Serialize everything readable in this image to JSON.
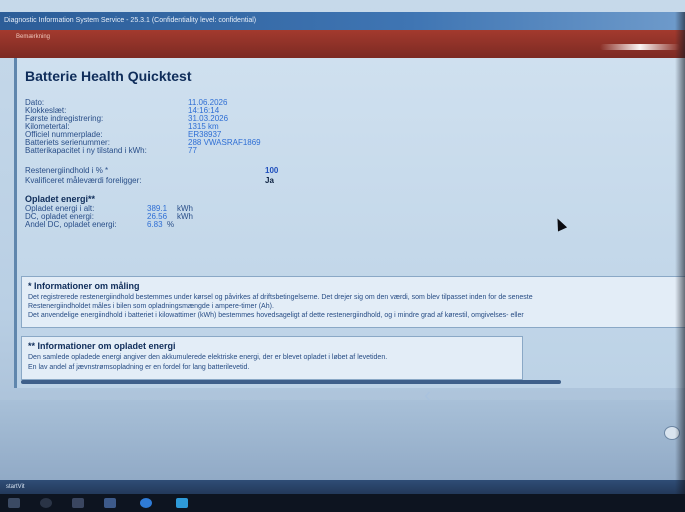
{
  "window": {
    "title": "Diagnostic Information System Service - 25.3.1 (Confidentiality level: confidential)"
  },
  "app": {
    "menu_label": "Bemærkning"
  },
  "page": {
    "heading": "Batterie Health Quicktest"
  },
  "details": [
    {
      "label": "Dato:",
      "value": "11.06.2026"
    },
    {
      "label": "Klokkeslæt:",
      "value": "14:16:14"
    },
    {
      "label": "Første indregistrering:",
      "value": "31.03.2026"
    },
    {
      "label": "Kilometertal:",
      "value": "1315 km"
    },
    {
      "label": "Officiel nummerplade:",
      "value": "ER38937"
    },
    {
      "label": "Batteriets serienummer:",
      "value": "288 VWASRAF1869"
    },
    {
      "label": "Batterikapacitet i ny tilstand i kWh:",
      "value": "77"
    }
  ],
  "residual": [
    {
      "label": "Restenergiindhold i % *",
      "value": "100"
    },
    {
      "label": "Kvalificeret måleværdi foreligger:",
      "value": "Ja"
    }
  ],
  "charged": {
    "title": "Opladet energi**",
    "rows": [
      {
        "label": "Opladet energi i alt:",
        "value": "389.1",
        "unit": "kWh"
      },
      {
        "label": "DC, opladet energi:",
        "value": "26.56",
        "unit": "kWh"
      },
      {
        "label": "Andel DC, opladet energi:",
        "value": "6.83",
        "unit": "%"
      }
    ]
  },
  "info_measure": {
    "title": "* Informationer om måling",
    "lines": [
      "Det registrerede restenergiindhold bestemmes under kørsel og påvirkes af driftsbetingelserne. Det drejer sig om den værdi, som blev tilpasset inden for de seneste",
      "Restenergiindholdet måles i bilen som opladningsmængde i ampere-timer (Ah).",
      "Det anvendelige energiindhold i batteriet i kilowattimer (kWh) bestemmes hovedsageligt af dette restenergiindhold, og i mindre grad af kørestil, omgivelses- eller"
    ]
  },
  "info_charged": {
    "title": "** Informationer om opladet energi",
    "lines": [
      "Den samlede opladede energi angiver den akkumulerede elektriske energi, der er blevet opladet i løbet af levetiden.",
      "En lav andel af jævnstrømsopladning er en fordel for lang batterilevetid."
    ]
  },
  "statusbar": {
    "text": "startVit"
  },
  "colors": {
    "accent_red": "#8f3127",
    "value_blue": "#2e6ed4",
    "label_blue": "#294e88"
  }
}
